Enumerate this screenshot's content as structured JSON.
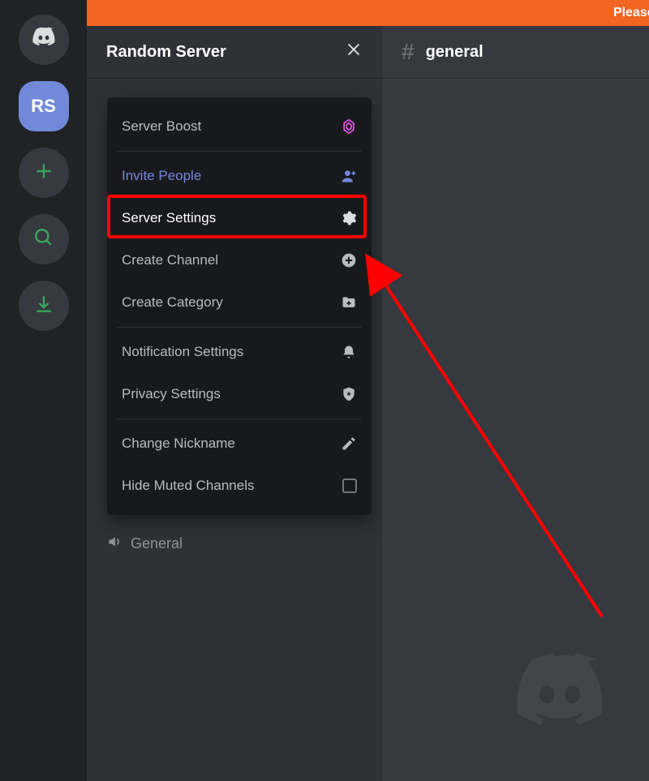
{
  "banner": {
    "text": "Please c"
  },
  "rail": {
    "server_initials": "RS"
  },
  "server_header": {
    "name": "Random Server"
  },
  "menu": {
    "items": [
      {
        "label": "Server Boost",
        "icon": "boost"
      },
      {
        "label": "Invite People",
        "icon": "invite",
        "accent": true
      },
      {
        "label": "Server Settings",
        "icon": "gear",
        "highlight": true
      },
      {
        "label": "Create Channel",
        "icon": "plus-circle"
      },
      {
        "label": "Create Category",
        "icon": "folder-plus"
      },
      {
        "label": "Notification Settings",
        "icon": "bell"
      },
      {
        "label": "Privacy Settings",
        "icon": "shield"
      },
      {
        "label": "Change Nickname",
        "icon": "pencil"
      },
      {
        "label": "Hide Muted Channels",
        "icon": "checkbox"
      }
    ]
  },
  "voice_channel": {
    "name": "General"
  },
  "chat": {
    "channel_name": "general"
  }
}
